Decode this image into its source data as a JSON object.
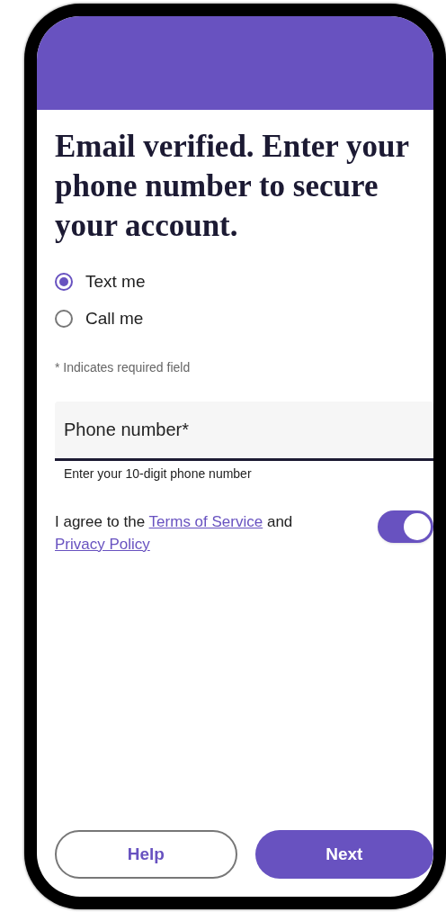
{
  "heading": "Email verified. Enter your phone number to secure your account.",
  "contact_method": [
    {
      "label": "Text me",
      "selected": true
    },
    {
      "label": "Call me",
      "selected": false
    }
  ],
  "required_note": "* Indicates required field",
  "phone_field": {
    "placeholder": "Phone number*",
    "helper": "Enter your 10-digit phone number"
  },
  "agreement": {
    "on": true,
    "parts": [
      {
        "kind": "text",
        "text": "I agree to the "
      },
      {
        "kind": "link",
        "text": "Terms of Service"
      },
      {
        "kind": "text",
        "text": " and "
      },
      {
        "kind": "link",
        "text": "Privacy Policy"
      }
    ]
  },
  "buttons": [
    {
      "kind": "secondary",
      "label": "Help"
    },
    {
      "kind": "primary",
      "label": "Next"
    }
  ]
}
